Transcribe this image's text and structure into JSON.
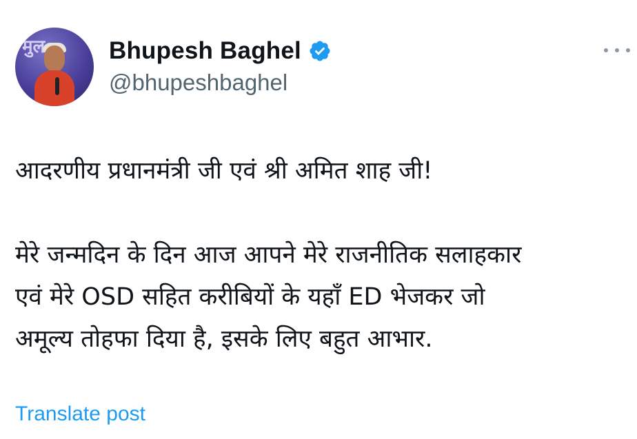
{
  "author": {
    "display_name": "Bhupesh Baghel",
    "handle": "@bhupeshbaghel",
    "verified_icon": "verified-badge-icon",
    "avatar_text": "मुल"
  },
  "tweet": {
    "line1": "आदरणीय प्रधानमंत्री जी एवं श्री अमित शाह जी!",
    "line2": "मेरे जन्मदिन के दिन आज आपने मेरे राजनीतिक सलाहकार",
    "line3": "एवं मेरे OSD सहित करीबियों के यहाँ ED भेजकर जो",
    "line4": "अमूल्य तोहफा दिया है, इसके लिए बहुत आभार."
  },
  "actions": {
    "translate_label": "Translate post",
    "more_icon": "more-options-icon"
  },
  "colors": {
    "link": "#1d9bf0",
    "handle": "#536471",
    "verified": "#1d9bf0",
    "text": "#0f1419"
  }
}
